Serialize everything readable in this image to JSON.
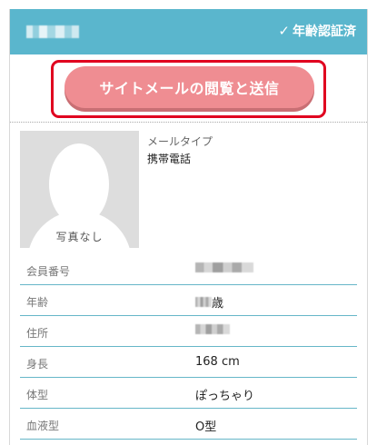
{
  "header": {
    "verified_label": "年齢認証済"
  },
  "mail_button": {
    "label": "サイトメールの閲覧と送信"
  },
  "profile": {
    "no_photo_label": "写真なし",
    "mail_type_label": "メールタイプ",
    "mail_type_value": "携帯電話"
  },
  "details": [
    {
      "label": "会員番号",
      "value": ""
    },
    {
      "label": "年齢",
      "value": "歳"
    },
    {
      "label": "住所",
      "value": ""
    },
    {
      "label": "身長",
      "value": "168 cm"
    },
    {
      "label": "体型",
      "value": "ぽっちゃり"
    },
    {
      "label": "血液型",
      "value": "O型"
    }
  ],
  "colors": {
    "header": "#5ab6cd",
    "button": "#ef8d92",
    "highlight": "#e0001f",
    "row_divider": "#66b6c8"
  },
  "icons": {
    "verified": "check-icon"
  }
}
